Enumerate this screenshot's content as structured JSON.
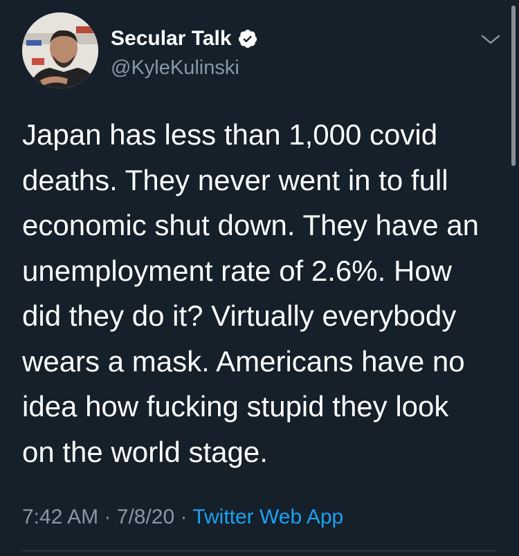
{
  "author": {
    "display_name": "Secular Talk",
    "handle": "@KyleKulinski",
    "verified": true,
    "avatar_icon": "avatar-photo"
  },
  "tweet": {
    "text_lines": [
      "Japan has less than 1,000 covid",
      "deaths. They never went in to full",
      "economic shut down. They have an",
      "unemployment rate of 2.6%. How",
      "did they do it? Virtually everybody",
      "wears a mask. Americans have no",
      "idea how fucking stupid they look",
      "on the world stage."
    ],
    "time": "7:42 AM",
    "date": "7/8/20",
    "separator": "·",
    "source": "Twitter Web App"
  },
  "icons": {
    "verified": "verified-badge-icon",
    "menu": "chevron-down-icon"
  },
  "colors": {
    "background": "#15202b",
    "text_primary": "#ffffff",
    "text_secondary": "#8899a6",
    "link": "#1da1f2",
    "divider": "#38444d"
  }
}
